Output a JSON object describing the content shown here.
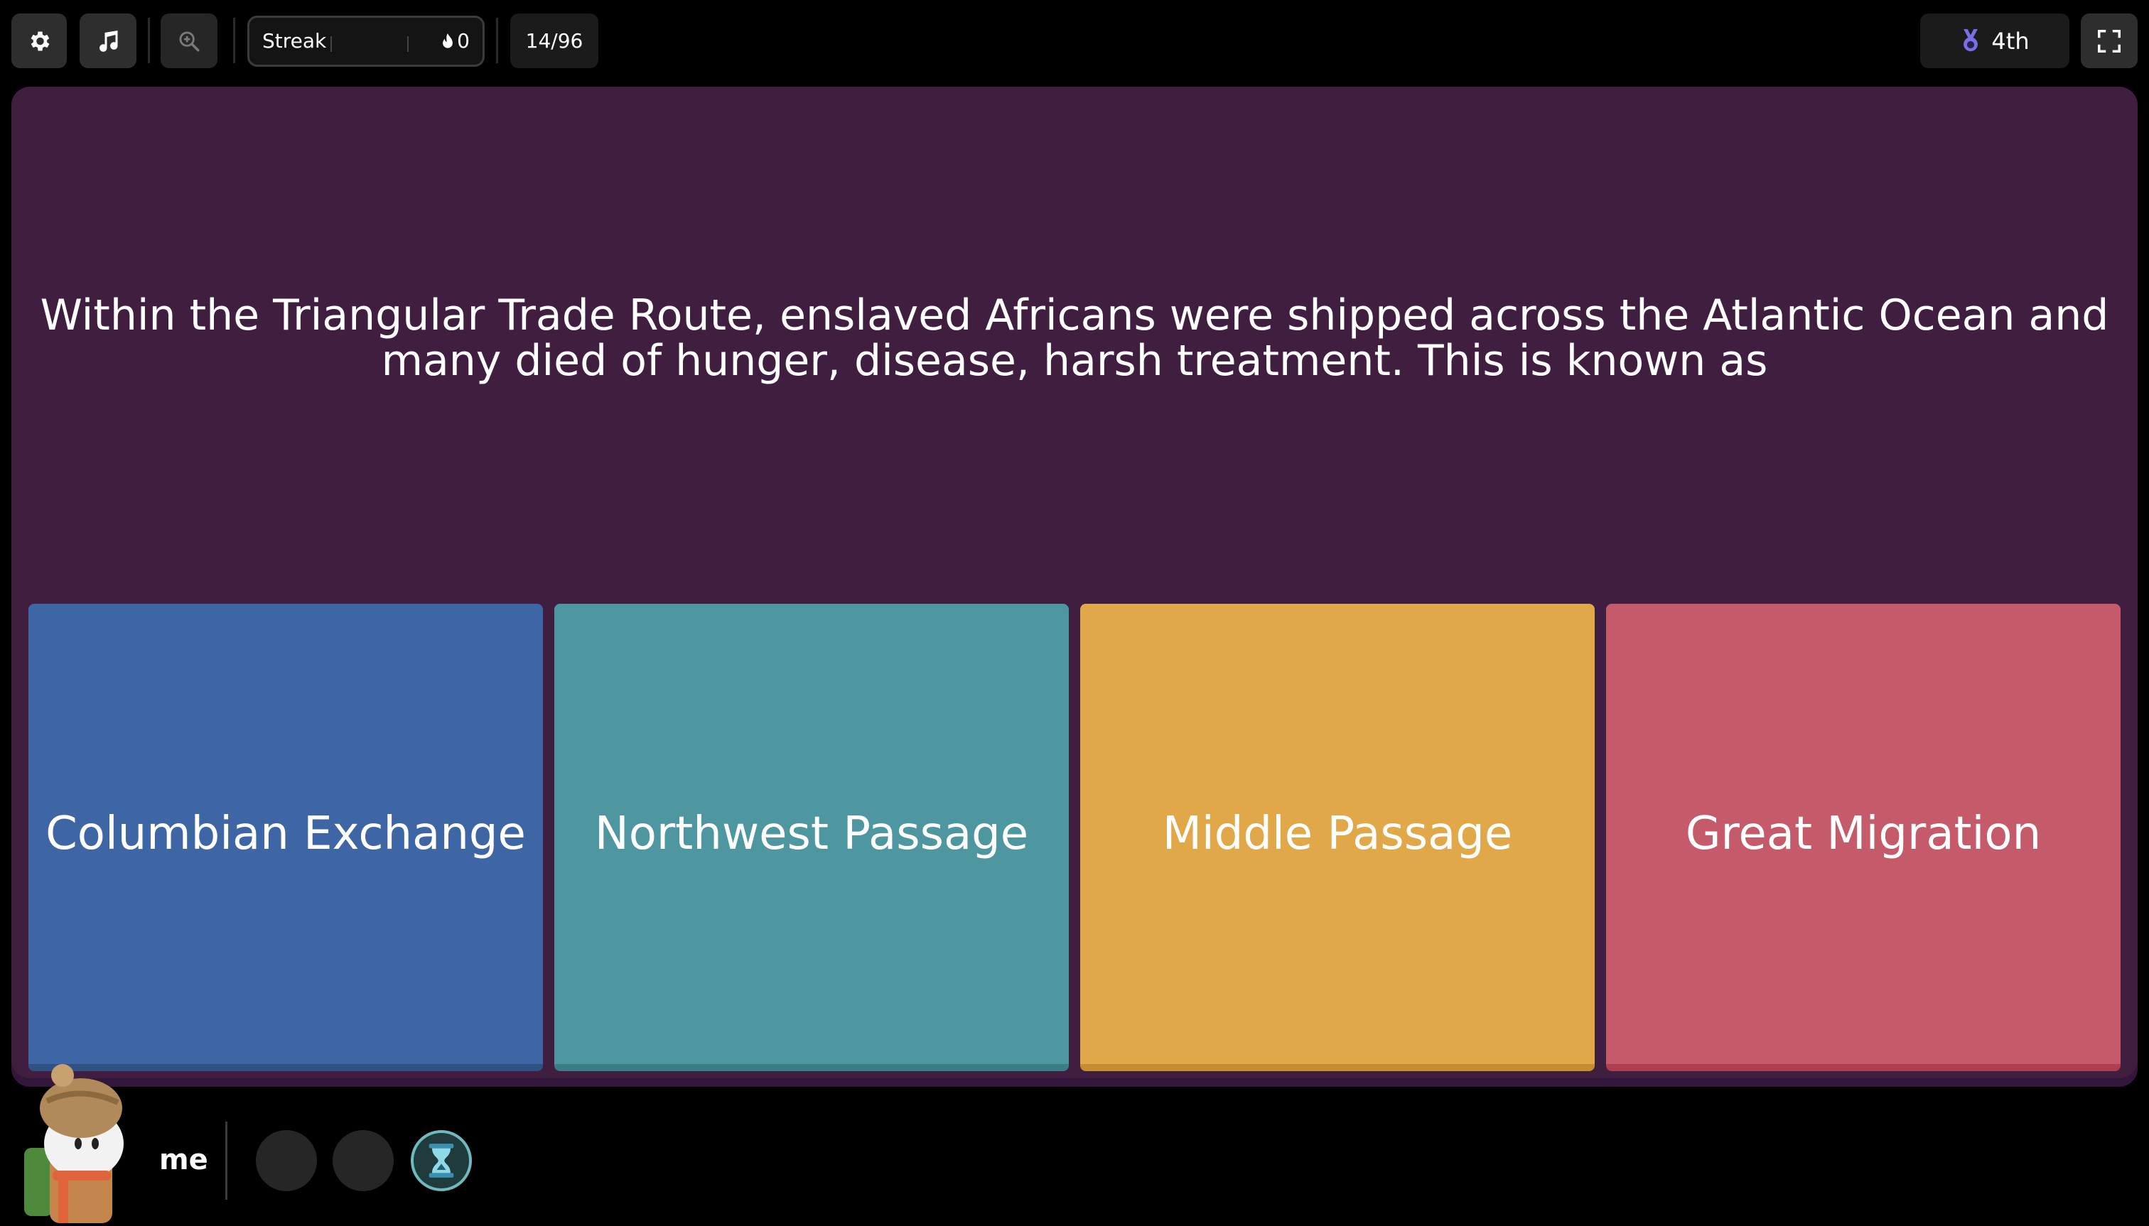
{
  "toolbar": {
    "settings_icon": "gear-icon",
    "music_icon": "music-note-icon",
    "zoom_icon": "zoom-in-icon",
    "fullscreen_icon": "fullscreen-icon"
  },
  "streak": {
    "label": "Streak",
    "count": "0"
  },
  "progress": "14/96",
  "rank": "4th",
  "question": "Within the Triangular Trade Route, enslaved Africans were shipped across the Atlantic Ocean and many died of hunger, disease, harsh treatment. This is known as",
  "answers": [
    {
      "label": "Columbian Exchange",
      "color": "#3e66a4"
    },
    {
      "label": "Northwest Passage",
      "color": "#4e97a0"
    },
    {
      "label": "Middle Passage",
      "color": "#e1a84a"
    },
    {
      "label": "Great Migration",
      "color": "#c55a6b"
    }
  ],
  "player": {
    "name": "me"
  },
  "colors": {
    "panel": "#401e40",
    "background": "#000000"
  }
}
